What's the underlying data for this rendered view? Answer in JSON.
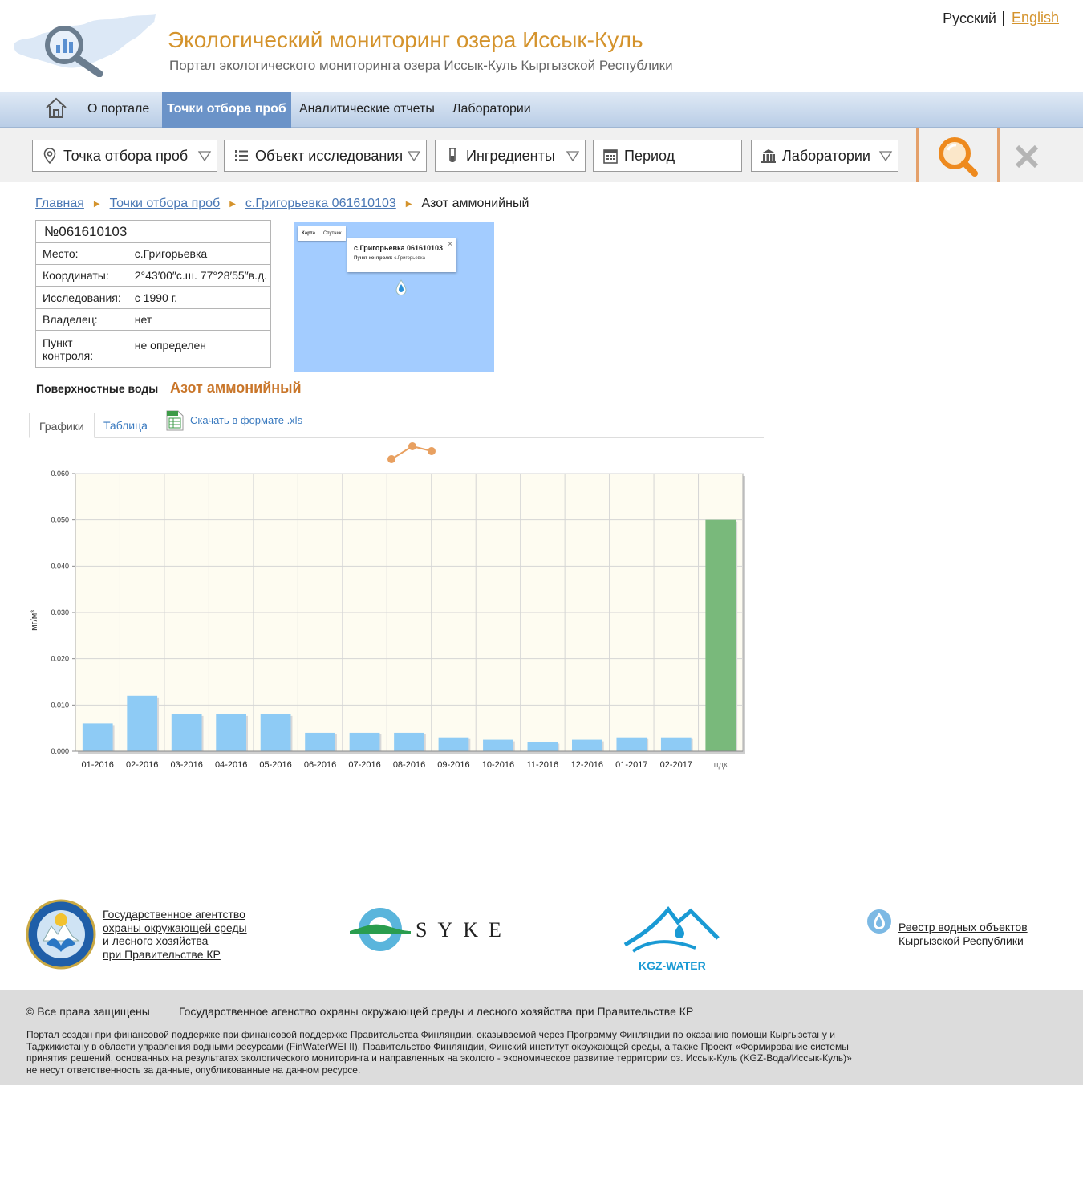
{
  "header": {
    "title": "Экологический мониторинг озера Иссык-Куль",
    "subtitle": "Портал экологического мониторинга озера Иссык-Куль Кыргызской Республики",
    "lang_ru": "Русский",
    "lang_en": "English"
  },
  "nav": {
    "items": [
      {
        "label": "О портале"
      },
      {
        "label": "Точки отбора проб"
      },
      {
        "label": "Аналитические отчеты"
      },
      {
        "label": "Лаборатории"
      }
    ],
    "active_index": 1
  },
  "filters": [
    {
      "label": "Точка отбора проб",
      "icon": "pin-icon"
    },
    {
      "label": "Объект исследования",
      "icon": "list-icon"
    },
    {
      "label": "Ингредиенты",
      "icon": "test-tube-icon"
    },
    {
      "label": "Период",
      "icon": "calendar-icon"
    },
    {
      "label": "Лаборатории",
      "icon": "building-icon"
    }
  ],
  "breadcrumb": {
    "items": [
      "Главная",
      "Точки отбора проб",
      "с.Григорьевка 061610103"
    ],
    "current": "Азот аммонийный"
  },
  "station": {
    "number": "№061610103",
    "rows": [
      {
        "key": "Место:",
        "value": "с.Григорьевка"
      },
      {
        "key": "Координаты:",
        "value": "2°43′00″с.ш. 77°28′55″в.д."
      },
      {
        "key": "Исследования:",
        "value": "с 1990 г."
      },
      {
        "key": "Владелец:",
        "value": "нет"
      },
      {
        "key": "Пункт контроля:",
        "value": "не определен"
      }
    ]
  },
  "map": {
    "type_map": "Карта",
    "type_satellite": "Спутник",
    "popup_title": "с.Григорьевка 061610103",
    "popup_label": "Пункт контроля:",
    "popup_value": "с.Григорьевка",
    "popup_close": "×"
  },
  "section": {
    "label": "Поверхностные воды",
    "parameter": "Азот аммонийный"
  },
  "tabs": {
    "charts": "Графики",
    "table": "Таблица",
    "download": "Скачать в формате .xls"
  },
  "chart_data": {
    "type": "bar",
    "categories": [
      "01-2016",
      "02-2016",
      "03-2016",
      "04-2016",
      "05-2016",
      "06-2016",
      "07-2016",
      "08-2016",
      "09-2016",
      "10-2016",
      "11-2016",
      "12-2016",
      "01-2017",
      "02-2017",
      "пдк"
    ],
    "values": [
      0.006,
      0.012,
      0.008,
      0.008,
      0.008,
      0.004,
      0.004,
      0.004,
      0.003,
      0.0025,
      0.002,
      0.0025,
      0.003,
      0.003,
      0.05
    ],
    "ylabel": "мг/м³",
    "ylim": [
      0,
      0.06
    ],
    "yticks": [
      "0.000",
      "0.010",
      "0.020",
      "0.030",
      "0.040",
      "0.050",
      "0.060"
    ],
    "grid": true,
    "colors": {
      "bar": "#8ecbf5",
      "limit_bar": "#79b97b",
      "plot_bg": "#fefcf1"
    }
  },
  "footer": {
    "agency_link": [
      "Государственное агентство",
      "охраны окружающей среды",
      "и лесного хозяйства",
      "при Правительстве КР"
    ],
    "syke": "SYKE",
    "kgz_water": "KGZ-WATER",
    "registry_link": [
      "Реестр водных объектов",
      "Кыргызской Республики"
    ],
    "copyright": "© Все права защищены",
    "agency_name": "Государственное агенство охраны окружающей среды и лесного хозяйства при Правительстве КР",
    "disclaimer": "Портал создан при финансовой поддержке при финансовой поддержке Правительства Финляндии, оказываемой через Программу Финляндии по оказанию помощи Кыргызстану и Таджикистану в области управления водными ресурсами (FinWaterWEI II). Правительство Финляндии, Финский институт окружающей среды, а также Проект «Формирование системы принятия решений, основанных на результатах экологического мониторинга и направленных на эколого - экономическое развитие территории оз. Иссык-Куль (KGZ-Вода/Иссык-Куль)» не несут ответственность за данные, опубликованные на данном ресурсе."
  }
}
